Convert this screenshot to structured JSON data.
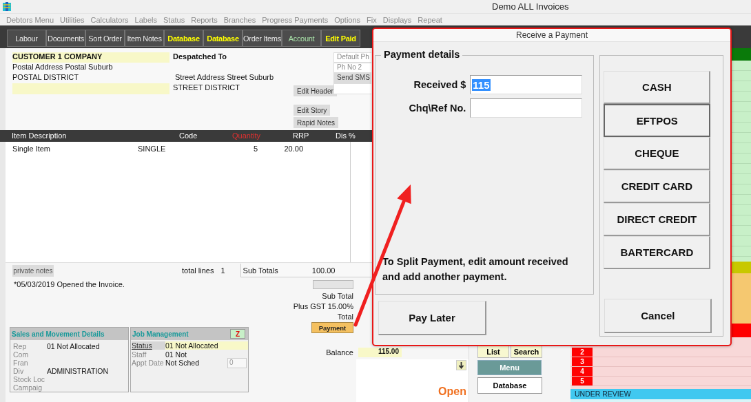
{
  "window": {
    "title": "Demo ALL Invoices"
  },
  "menu": [
    "Debtors Menu",
    "Utilities",
    "Calculators",
    "Labels",
    "Status",
    "Reports",
    "Branches",
    "Progress Payments",
    "Options",
    "Fix",
    "Displays",
    "Repeat"
  ],
  "toolbar": [
    {
      "label": "Labour",
      "color": "#e8e8e8",
      "bold": false
    },
    {
      "label": "Documents",
      "color": "#e8e8e8",
      "bold": false
    },
    {
      "label": "Sort Order",
      "color": "#e8e8e8",
      "bold": false
    },
    {
      "label": "Item Notes",
      "color": "#e8e8e8",
      "bold": false
    },
    {
      "label": "Database",
      "color": "#ffff00",
      "bold": true
    },
    {
      "label": "Database",
      "color": "#ffff00",
      "bold": true
    },
    {
      "label": "Order Items",
      "color": "#e8e8e8",
      "bold": false
    },
    {
      "label": "Account",
      "color": "#a8e0a8",
      "bold": false
    },
    {
      "label": "Edit Paid",
      "color": "#ffff00",
      "bold": true
    }
  ],
  "customer": {
    "name": "CUSTOMER 1 COMPANY",
    "postal_address": "Postal Address Postal Suburb",
    "postal_district": "POSTAL DISTRICT",
    "despatch_heading": "Despatched To",
    "street_address": "Street Address Street Suburb",
    "street_district": "STREET DISTRICT"
  },
  "header_buttons": [
    "Edit Header",
    "Edit Story",
    "Rapid Notes"
  ],
  "phone_buttons": [
    "Default Ph",
    "Ph No 2",
    "Send SMS"
  ],
  "items_table": {
    "columns": [
      {
        "label": "Item Description",
        "color": "#ffffff"
      },
      {
        "label": "Code",
        "color": "#ffffff"
      },
      {
        "label": "Quantity",
        "color": "#e03030"
      },
      {
        "label": "RRP",
        "color": "#ffffff"
      },
      {
        "label": "Dis %",
        "color": "#ffffff"
      }
    ],
    "rows": [
      {
        "description": "Single Item",
        "code": "SINGLE",
        "quantity": "5",
        "rrp": "20.00"
      }
    ]
  },
  "totals": {
    "private_notes": "private notes",
    "total_lines_label": "total lines",
    "total_lines": "1",
    "sub_totals_label": "Sub Totals",
    "sub_totals": "100.00"
  },
  "log": "*05/03/2019  Opened the Invoice.",
  "summary": {
    "labels": [
      "Sub Total",
      "Plus GST 15.00%",
      "Total"
    ],
    "payment_button": "Payment",
    "balance_label": "Balance",
    "balance": "115.00"
  },
  "sales_panel": {
    "title": "Sales and Movement Details",
    "fields": [
      {
        "label": "Rep",
        "value": "01 Not Allocated"
      },
      {
        "label": "Com"
      },
      {
        "label": "Fran"
      },
      {
        "label": "Div",
        "value": "ADMINISTRATION"
      },
      {
        "label": "Stock Loc"
      },
      {
        "label": "Campaig"
      }
    ]
  },
  "job_panel": {
    "title": "Job Management",
    "badge": "Z",
    "fields": [
      {
        "label": "Status",
        "value": "01 Not Allocated",
        "highlighted": true
      },
      {
        "label": "Staff",
        "value": "01 Not",
        "highlighted": false
      },
      {
        "label": "Appt Date",
        "value": "Not Sched",
        "highlighted": false
      }
    ],
    "appt_count": "0"
  },
  "status": "Open",
  "nav_buttons": [
    "List",
    "Search",
    "Menu",
    "Database"
  ],
  "status_strip": {
    "rows": [
      "2",
      "3",
      "4",
      "5"
    ],
    "footer": "UNDER REVIEW"
  },
  "dialog": {
    "title": "Receive a Payment",
    "group_title": "Payment details",
    "fields": [
      {
        "label": "Received $",
        "value": "115",
        "selected": true
      },
      {
        "label": "Chq\\Ref No.",
        "selected": false
      }
    ],
    "note": "To Split Payment, edit amount received and add another payment.",
    "methods": [
      {
        "label": "CASH",
        "selected": false
      },
      {
        "label": "EFTPOS",
        "selected": true
      },
      {
        "label": "CHEQUE",
        "selected": false
      },
      {
        "label": "CREDIT CARD",
        "selected": false
      },
      {
        "label": "DIRECT CREDIT",
        "selected": false
      },
      {
        "label": "BARTERCARD",
        "selected": false
      }
    ],
    "pay_later": "Pay Later",
    "cancel": "Cancel"
  }
}
